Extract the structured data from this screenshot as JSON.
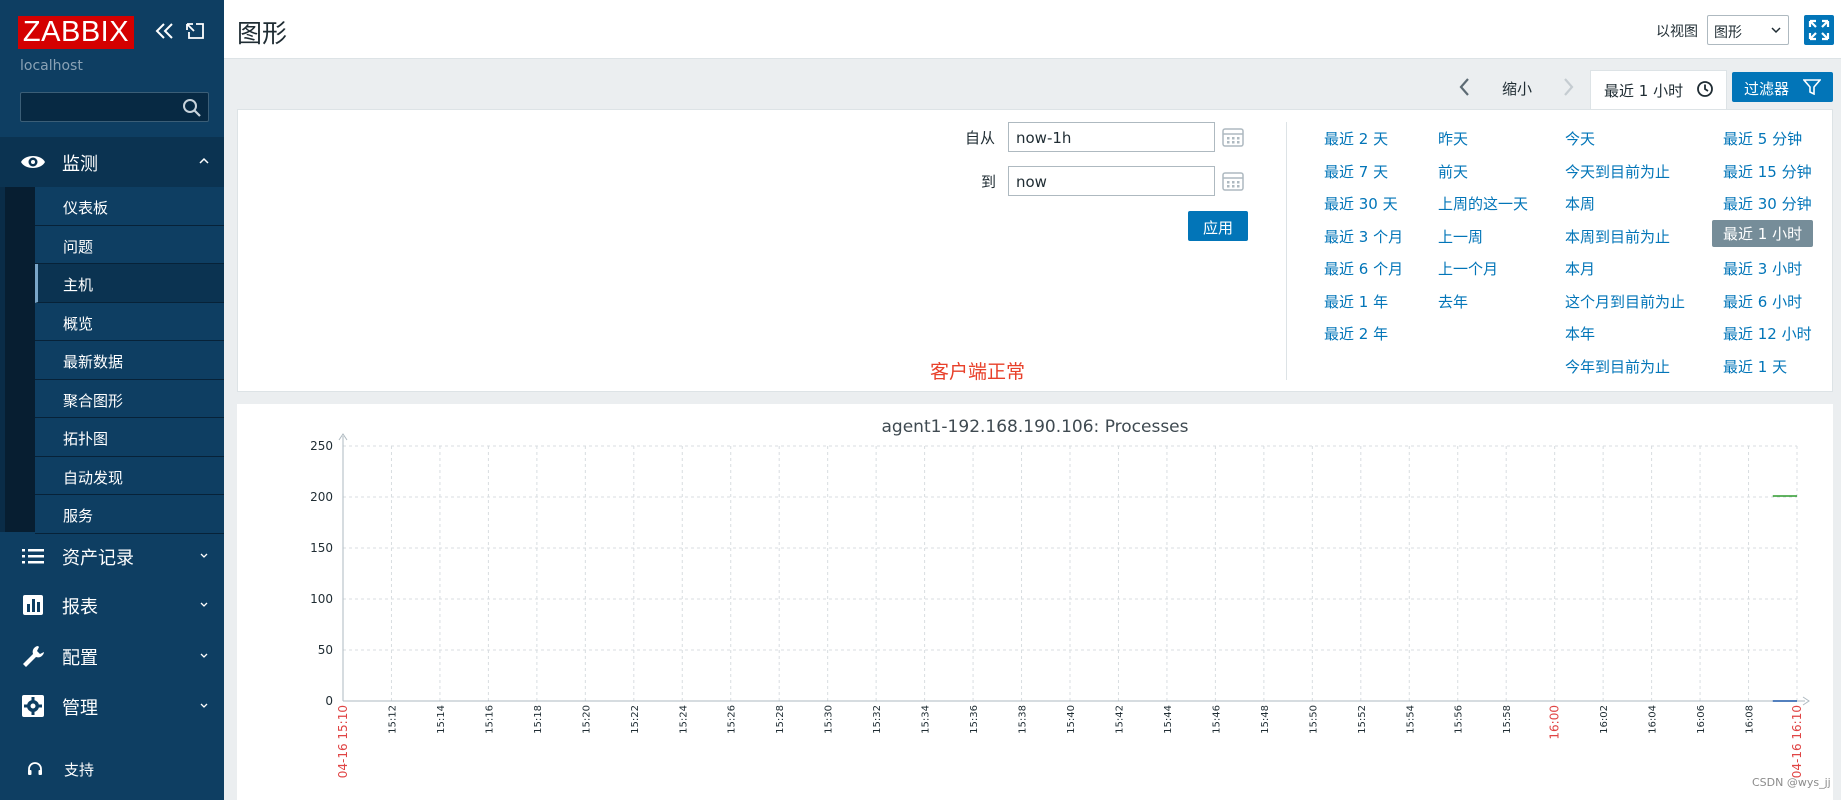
{
  "app": {
    "logo": "ZABBIX",
    "server_name": "localhost",
    "search_placeholder": ""
  },
  "sidebar": {
    "sections": [
      {
        "label": "监测",
        "icon": "eye-icon"
      },
      {
        "label": "资产记录",
        "icon": "list-icon"
      },
      {
        "label": "报表",
        "icon": "report-icon"
      },
      {
        "label": "配置",
        "icon": "wrench-icon"
      },
      {
        "label": "管理",
        "icon": "gear-icon"
      }
    ],
    "monitor_items": [
      "仪表板",
      "问题",
      "主机",
      "概览",
      "最新数据",
      "聚合图形",
      "拓扑图",
      "自动发现",
      "服务"
    ],
    "active_item": "主机",
    "support_label": "支持"
  },
  "header": {
    "title": "图形",
    "view_as_label": "以视图",
    "view_select_value": "图形"
  },
  "filter_bar": {
    "zoom_out_label": "缩小",
    "time_tab_label": "最近 1 小时",
    "filter_button_label": "过滤器"
  },
  "filter_panel": {
    "from_label": "自从",
    "from_value": "now-1h",
    "to_label": "到",
    "to_value": "now",
    "apply_label": "应用",
    "client_note": "客户端正常",
    "quick_ranges": [
      [
        "最近 2 天",
        "最近 7 天",
        "最近 30 天",
        "最近 3 个月",
        "最近 6 个月",
        "最近 1 年",
        "最近 2 年"
      ],
      [
        "昨天",
        "前天",
        "上周的这一天",
        "上一周",
        "上一个月",
        "去年"
      ],
      [
        "今天",
        "今天到目前为止",
        "本周",
        "本周到目前为止",
        "本月",
        "这个月到目前为止",
        "本年",
        "今年到目前为止"
      ],
      [
        "最近 5 分钟",
        "最近 15 分钟",
        "最近 30 分钟",
        "最近 1 小时",
        "最近 3 小时",
        "最近 6 小时",
        "最近 12 小时",
        "最近 1 天"
      ]
    ],
    "selected_range": "最近 1 小时"
  },
  "graph": {
    "title": "agent1-192.168.190.106: Processes"
  },
  "chart_data": {
    "type": "line",
    "title": "agent1-192.168.190.106: Processes",
    "xlabel": "",
    "ylabel": "",
    "ylim": [
      0,
      250
    ],
    "y_ticks": [
      0,
      50,
      100,
      150,
      200,
      250
    ],
    "x_ticks": [
      "04-16 15:10",
      "15:12",
      "15:14",
      "15:16",
      "15:18",
      "15:20",
      "15:22",
      "15:24",
      "15:26",
      "15:28",
      "15:30",
      "15:32",
      "15:34",
      "15:36",
      "15:38",
      "15:40",
      "15:42",
      "15:44",
      "15:46",
      "15:48",
      "15:50",
      "15:52",
      "15:54",
      "15:56",
      "15:58",
      "16:00",
      "16:02",
      "16:04",
      "16:06",
      "16:08",
      "04-16 16:10"
    ],
    "highlight_ticks": [
      "04-16 15:10",
      "16:00",
      "04-16 16:10"
    ],
    "grid": true,
    "series": [
      {
        "color": "#2e9c2e",
        "x": [
          "16:09",
          "16:10"
        ],
        "values": [
          201,
          201
        ]
      },
      {
        "color": "#1a56a8",
        "x": [
          "16:09",
          "16:10"
        ],
        "values": [
          0,
          0
        ]
      }
    ]
  },
  "watermark": "CSDN @wys_jj",
  "colors": {
    "sidebar": "#0e3e62",
    "accent": "#0275b8",
    "logo": "#d40000",
    "highlight_tick": "#e04545",
    "note": "#e8402a"
  }
}
